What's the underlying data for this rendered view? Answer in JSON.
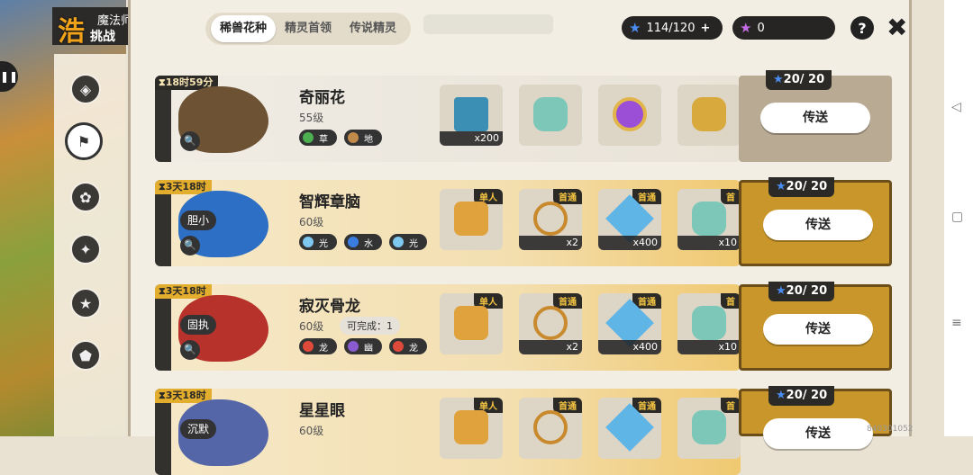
{
  "header": {
    "logo_mark": "浩",
    "logo_title": "魔法师手册",
    "logo_sub": "挑战",
    "tabs": [
      "稀兽花种",
      "精灵首领",
      "传说精灵"
    ],
    "stamina": "114/120",
    "stamina_plus": "+",
    "currency": "0",
    "help": "?",
    "close": "✖"
  },
  "colors": {
    "blue_star": "#3f7fe0",
    "purple_star": "#b25ad9",
    "gold_card": "#f3dfb0",
    "dark": "#2b2a27"
  },
  "cards": [
    {
      "timer": "18时59分",
      "name": "奇丽花",
      "level": "55级",
      "badge": "",
      "extra": "",
      "elements": [
        "草",
        "地"
      ],
      "items": [
        {
          "tag": "",
          "count": "x200"
        },
        {
          "tag": "",
          "count": ""
        },
        {
          "tag": "",
          "count": ""
        },
        {
          "tag": "",
          "count": ""
        }
      ],
      "cost": "20/ 20",
      "button": "传送"
    },
    {
      "timer": "3天18时",
      "name": "智辉章脑",
      "level": "60级",
      "badge": "胆小",
      "extra": "",
      "elements": [
        "光",
        "水",
        "光"
      ],
      "items": [
        {
          "tag": "单人",
          "count": ""
        },
        {
          "tag": "首通",
          "count": "x2"
        },
        {
          "tag": "首通",
          "count": "x400"
        },
        {
          "tag": "首",
          "count": "x10"
        }
      ],
      "cost": "20/ 20",
      "button": "传送"
    },
    {
      "timer": "3天18时",
      "name": "寂灭骨龙",
      "level": "60级",
      "badge": "固执",
      "extra": "可完成：1",
      "elements": [
        "龙",
        "幽",
        "龙"
      ],
      "items": [
        {
          "tag": "单人",
          "count": ""
        },
        {
          "tag": "首通",
          "count": "x2"
        },
        {
          "tag": "首通",
          "count": "x400"
        },
        {
          "tag": "首",
          "count": "x10"
        }
      ],
      "cost": "20/ 20",
      "button": "传送"
    },
    {
      "timer": "3天18时",
      "name": "星星眼",
      "level": "60级",
      "badge": "沉默",
      "extra": "",
      "elements": [],
      "items": [
        {
          "tag": "单人",
          "count": ""
        },
        {
          "tag": "首通",
          "count": ""
        },
        {
          "tag": "首通",
          "count": ""
        },
        {
          "tag": "首",
          "count": ""
        }
      ],
      "cost": "20/ 20",
      "button": "传送"
    }
  ],
  "uid": "840301052"
}
